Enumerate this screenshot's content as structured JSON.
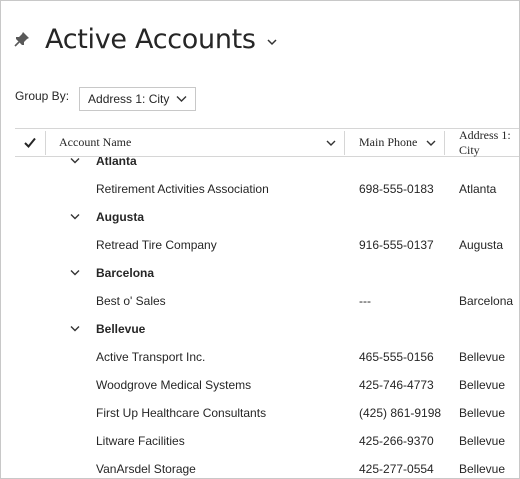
{
  "view": {
    "title": "Active Accounts"
  },
  "group_by": {
    "label": "Group By:",
    "value": "Address 1: City"
  },
  "columns": [
    {
      "label": "Account Name"
    },
    {
      "label": "Main Phone"
    },
    {
      "label": "Address 1: City"
    }
  ],
  "groups": [
    {
      "name": "Atlanta",
      "rows": [
        {
          "name": "Retirement Activities Association",
          "phone": "698-555-0183",
          "city": "Atlanta"
        }
      ]
    },
    {
      "name": "Augusta",
      "rows": [
        {
          "name": "Retread Tire Company",
          "phone": "916-555-0137",
          "city": "Augusta"
        }
      ]
    },
    {
      "name": "Barcelona",
      "rows": [
        {
          "name": "Best o' Sales",
          "phone": "---",
          "city": "Barcelona"
        }
      ]
    },
    {
      "name": "Bellevue",
      "rows": [
        {
          "name": "Active Transport Inc.",
          "phone": "465-555-0156",
          "city": "Bellevue"
        },
        {
          "name": "Woodgrove Medical Systems",
          "phone": "425-746-4773",
          "city": "Bellevue"
        },
        {
          "name": "First Up Healthcare Consultants",
          "phone": "(425) 861-9198",
          "city": "Bellevue"
        },
        {
          "name": "Litware Facilities",
          "phone": "425-266-9370",
          "city": "Bellevue"
        },
        {
          "name": "VanArsdel Storage",
          "phone": "425-277-0554",
          "city": "Bellevue"
        }
      ]
    }
  ],
  "icons": {
    "pin": "pin-icon",
    "title_dropdown": "chevron-down-icon",
    "select_all": "checkmark-icon",
    "column_menu": "chevron-down-icon",
    "group_toggle": "chevron-down-icon"
  }
}
